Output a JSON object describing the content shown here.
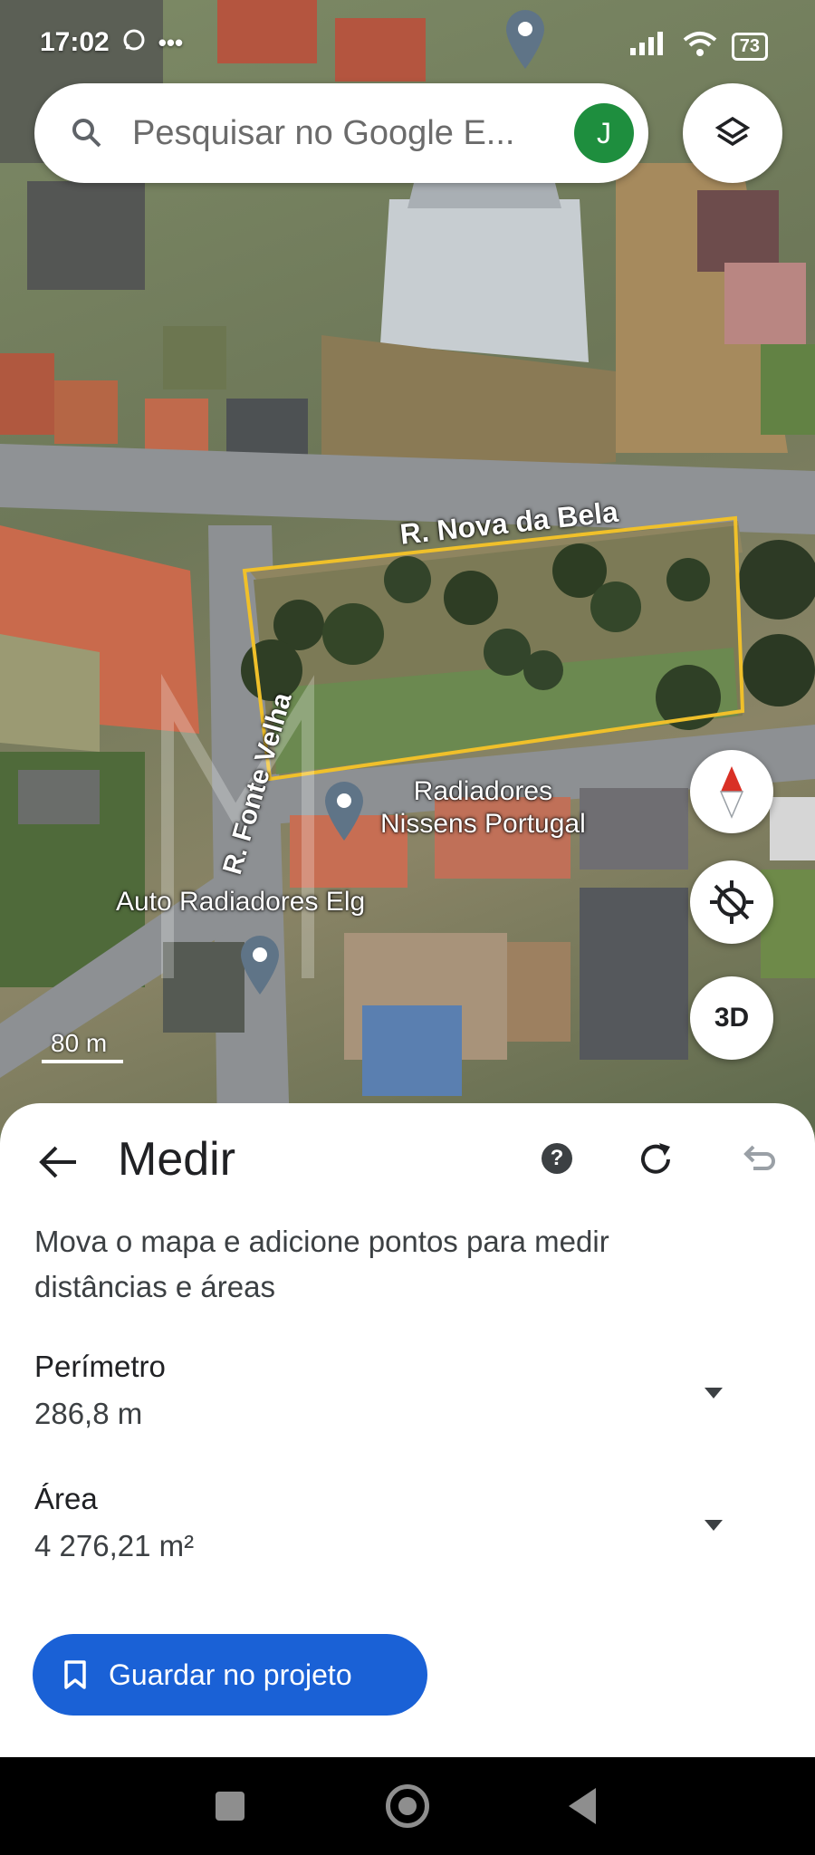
{
  "status_bar": {
    "time": "17:02",
    "left_icons": [
      "whatsapp-icon",
      "more-icon"
    ],
    "battery": "73",
    "right_icons": [
      "signal-icon",
      "wifi-icon",
      "battery-icon"
    ]
  },
  "search": {
    "placeholder": "Pesquisar no Google E...",
    "avatar_letter": "J",
    "avatar_color": "#1e8e3e"
  },
  "map": {
    "streets": [
      "R. Nova da Bela",
      "R. Fonte Velha"
    ],
    "pois": [
      {
        "line1": "Radiadores",
        "line2": "Nissens Portugal"
      },
      {
        "line1": "Auto Radiadores Elg",
        "line2": ""
      }
    ],
    "scale": "80 m",
    "buttons": {
      "three_d": "3D"
    },
    "polygon_color": "#f0c02a"
  },
  "sheet": {
    "title": "Medir",
    "description": "Mova o mapa e adicione pontos para medir distâncias e áreas",
    "perimeter_label": "Perímetro",
    "perimeter_value": "286,8 m",
    "area_label": "Área",
    "area_value": "4 276,21 m²",
    "save_button": "Guardar no projeto",
    "accent": "#1a61d6"
  }
}
